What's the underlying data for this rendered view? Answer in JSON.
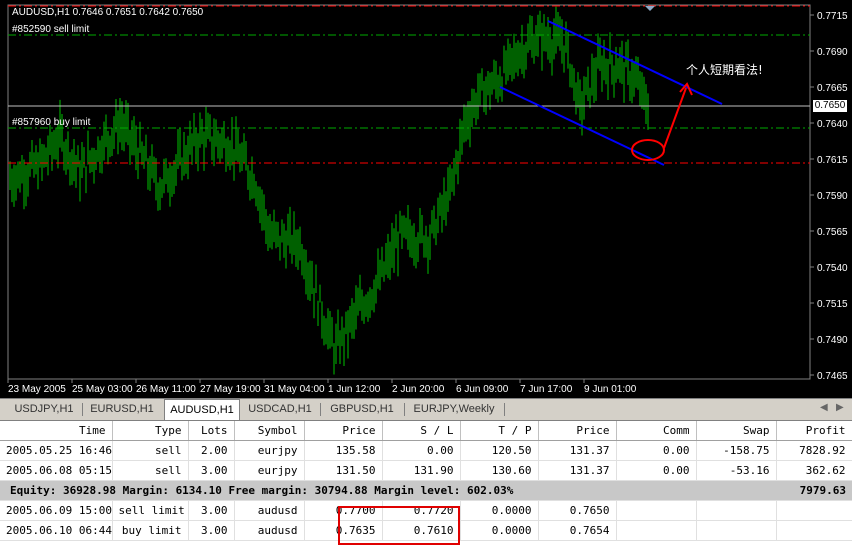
{
  "chart": {
    "header": "AUDUSD,H1  0.7646 0.7651 0.7642 0.7650",
    "sell_limit_label": "#852590 sell limit",
    "buy_limit_label": "#857960 buy limit",
    "annotation": "个人短期看法!",
    "current_price": "0.7650",
    "price_ticks": [
      "0.7715",
      "0.7690",
      "0.7665",
      "0.7640",
      "0.7615",
      "0.7590",
      "0.7565",
      "0.7540",
      "0.7515",
      "0.7490",
      "0.7465"
    ],
    "time_ticks": [
      "23 May 2005",
      "25 May 03:00",
      "26 May 11:00",
      "27 May 19:00",
      "31 May 04:00",
      "1 Jun 12:00",
      "2 Jun 20:00",
      "6 Jun 09:00",
      "7 Jun 17:00",
      "9 Jun 01:00"
    ],
    "colors": {
      "candles": "#00c000",
      "sell_line": "#00aa00",
      "buy_line": "#00aa00",
      "stop_line": "#ff0000",
      "channel": "#0000ff",
      "arrow": "#ff0000"
    }
  },
  "tabs": [
    {
      "label": "USDJPY,H1"
    },
    {
      "label": "EURUSD,H1"
    },
    {
      "label": "AUDUSD,H1",
      "active": true
    },
    {
      "label": "USDCAD,H1"
    },
    {
      "label": "GBPUSD,H1"
    },
    {
      "label": "EURJPY,Weekly"
    }
  ],
  "table": {
    "columns": [
      "Time",
      "Type",
      "Lots",
      "Symbol",
      "Price",
      "S / L",
      "T / P",
      "Price",
      "Comm",
      "Swap",
      "Profit"
    ],
    "trades": [
      [
        "2005.05.25 16:46",
        "sell",
        "2.00",
        "eurjpy",
        "135.58",
        "0.00",
        "120.50",
        "131.37",
        "0.00",
        "-158.75",
        "7828.92"
      ],
      [
        "2005.06.08 05:15",
        "sell",
        "3.00",
        "eurjpy",
        "131.50",
        "131.90",
        "130.60",
        "131.37",
        "0.00",
        "-53.16",
        "362.62"
      ]
    ],
    "summary": {
      "text": "Equity: 36928.98  Margin: 6134.10  Free margin: 30794.88  Margin level: 602.03%",
      "profit": "7979.63"
    },
    "orders": [
      [
        "2005.06.09 15:00",
        "sell limit",
        "3.00",
        "audusd",
        "0.7700",
        "0.7720",
        "0.0000",
        "0.7650",
        "",
        "",
        ""
      ],
      [
        "2005.06.10 06:44",
        "buy limit",
        "3.00",
        "audusd",
        "0.7635",
        "0.7610",
        "0.0000",
        "0.7654",
        "",
        "",
        ""
      ]
    ]
  }
}
